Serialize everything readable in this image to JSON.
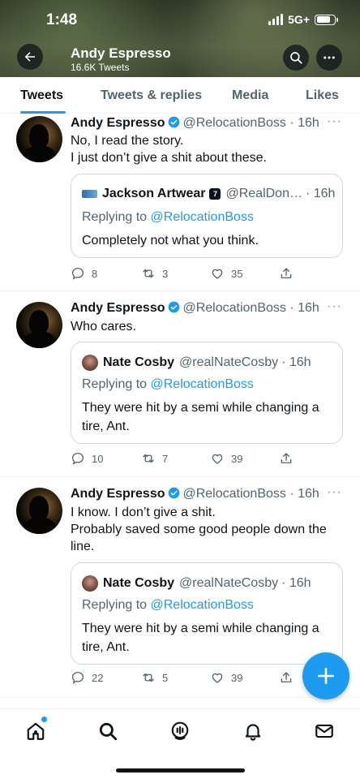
{
  "status_bar": {
    "time": "1:48",
    "network": "5G+"
  },
  "profile": {
    "name": "Andy Espresso",
    "tweet_count": "16.6K Tweets"
  },
  "tabs": [
    {
      "label": "Tweets",
      "active": true
    },
    {
      "label": "Tweets & replies",
      "active": false
    },
    {
      "label": "Media",
      "active": false
    },
    {
      "label": "Likes",
      "active": false
    }
  ],
  "tweets": [
    {
      "name": "Andy Espresso",
      "handle": "@RelocationBoss",
      "time": "· 16h",
      "text": "No, I read the story.\nI just don’t give a shit about these.",
      "quote": {
        "name": "Jackson Artwear",
        "handle": "@RealDon…",
        "time": "· 16h",
        "replying_prefix": "Replying to",
        "replying_to": "@RelocationBoss",
        "text": "Completely not what you think."
      },
      "replies": "8",
      "retweets": "3",
      "likes": "35"
    },
    {
      "name": "Andy Espresso",
      "handle": "@RelocationBoss",
      "time": "· 16h",
      "text": "Who cares.",
      "quote": {
        "name": "Nate Cosby",
        "handle": "@realNateCosby",
        "time": "· 16h",
        "replying_prefix": "Replying to",
        "replying_to": "@RelocationBoss",
        "text": "They were hit by a semi while changing a tire, Ant."
      },
      "replies": "10",
      "retweets": "7",
      "likes": "39"
    },
    {
      "name": "Andy Espresso",
      "handle": "@RelocationBoss",
      "time": "· 16h",
      "text": "I know. I don’t give a shit.\nProbably saved some good people down the line.",
      "quote": {
        "name": "Nate Cosby",
        "handle": "@realNateCosby",
        "time": "· 16h",
        "replying_prefix": "Replying to",
        "replying_to": "@RelocationBoss",
        "text": "They were hit by a semi while changing a tire, Ant."
      },
      "replies": "22",
      "retweets": "5",
      "likes": "39"
    }
  ],
  "colors": {
    "accent": "#1d9bf0",
    "text": "#0f1419",
    "muted": "#536471"
  }
}
